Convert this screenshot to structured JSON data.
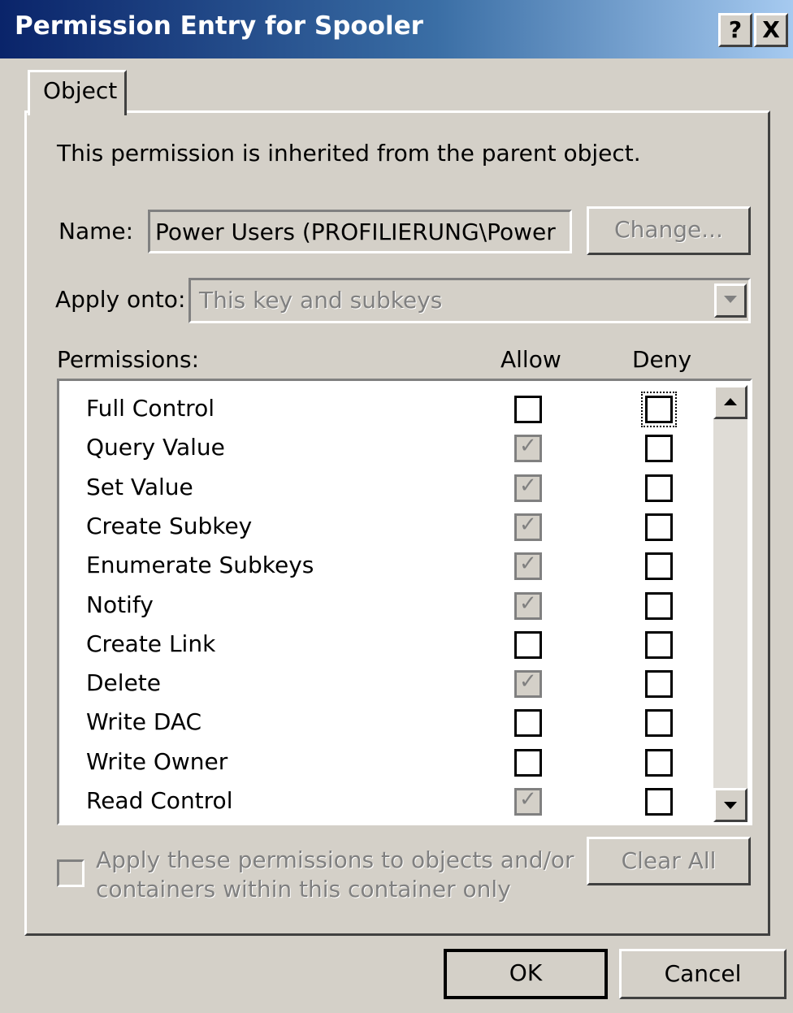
{
  "window": {
    "title": "Permission Entry for Spooler",
    "help_btn": "?",
    "close_btn": "X"
  },
  "tab": {
    "label": "Object"
  },
  "inherit_text": "This permission is inherited from the parent object.",
  "name": {
    "label": "Name:",
    "value": "Power Users (PROFILIERUNG\\Power",
    "change_btn": "Change..."
  },
  "apply": {
    "label": "Apply onto:",
    "value": "This key and subkeys"
  },
  "permissions": {
    "label": "Permissions:",
    "allow_header": "Allow",
    "deny_header": "Deny",
    "rows": [
      {
        "name": "Full Control",
        "allow": false,
        "deny": false
      },
      {
        "name": "Query Value",
        "allow": true,
        "deny": false
      },
      {
        "name": "Set Value",
        "allow": true,
        "deny": false
      },
      {
        "name": "Create Subkey",
        "allow": true,
        "deny": false
      },
      {
        "name": "Enumerate Subkeys",
        "allow": true,
        "deny": false
      },
      {
        "name": "Notify",
        "allow": true,
        "deny": false
      },
      {
        "name": "Create Link",
        "allow": false,
        "deny": false
      },
      {
        "name": "Delete",
        "allow": true,
        "deny": false
      },
      {
        "name": "Write DAC",
        "allow": false,
        "deny": false
      },
      {
        "name": "Write Owner",
        "allow": false,
        "deny": false
      },
      {
        "name": "Read Control",
        "allow": true,
        "deny": false
      }
    ]
  },
  "apply_children": {
    "line1": "Apply these permissions to objects and/or",
    "line2": "containers within this container only",
    "checked": false
  },
  "clear_all": "Clear All",
  "buttons": {
    "ok": "OK",
    "cancel": "Cancel"
  },
  "icons": {
    "scroll_up": "scroll-up-arrow-icon",
    "scroll_down": "scroll-down-arrow-icon",
    "dropdown": "chevron-down-icon"
  }
}
